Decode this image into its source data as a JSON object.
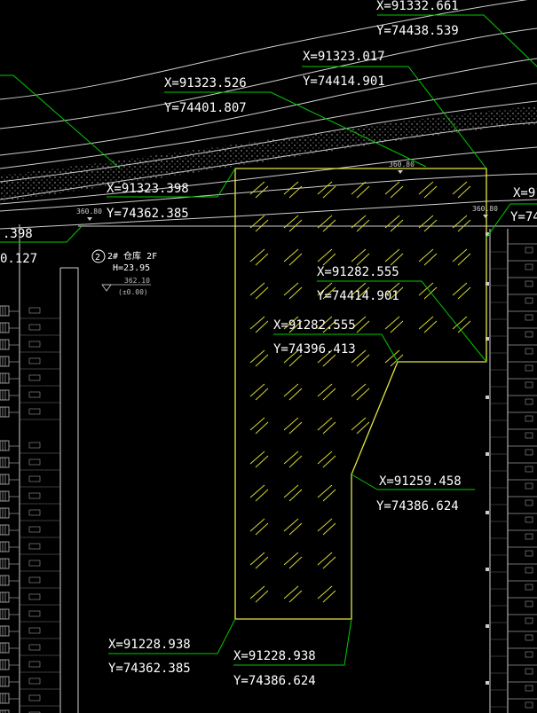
{
  "coordinate_labels": [
    {
      "id": "c1",
      "x": "X=91332.661",
      "y": "Y=74438.539"
    },
    {
      "id": "c2",
      "x": "X=91323.017",
      "y": "Y=74414.901"
    },
    {
      "id": "c3",
      "x": "X=91323.526",
      "y": "Y=74401.807"
    },
    {
      "id": "c4",
      "x": "X=91323.398",
      "y": "Y=74362.385"
    },
    {
      "id": "c5",
      "x": "X=91282.555",
      "y": "Y=74414.901"
    },
    {
      "id": "c6",
      "x": "X=91282.555",
      "y": "Y=74396.413"
    },
    {
      "id": "c7",
      "x": "X=91259.458",
      "y": "Y=74386.624"
    },
    {
      "id": "c8",
      "x": "X=91228.938",
      "y": "Y=74362.385"
    },
    {
      "id": "c9",
      "x": "X=91228.938",
      "y": "Y=74386.624"
    },
    {
      "id": "c10",
      "x": ".398",
      "y": "0.127"
    },
    {
      "id": "c11",
      "x": "X=91",
      "y": "Y=74"
    }
  ],
  "elevation_marks": [
    "360.80",
    "360.80",
    "360.80"
  ],
  "building": {
    "number": "2",
    "name": "2# 仓库 2F",
    "height": "H=23.95",
    "elevation": "362.10",
    "zero": "(±0.00)"
  },
  "colors": {
    "background": "#000000",
    "leader": "#00cc00",
    "outline": "#e6e640",
    "hatch": "#d8d830",
    "text": "#ffffff",
    "linework": "#cfcfcf"
  }
}
